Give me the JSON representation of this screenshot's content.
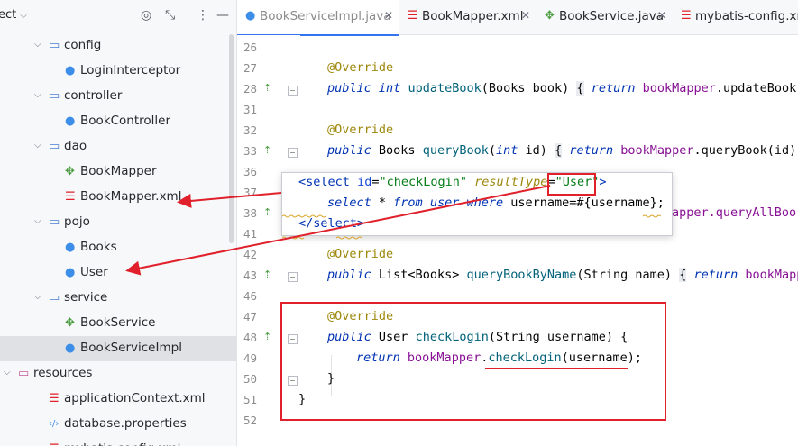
{
  "project_panel": {
    "title": "ect",
    "tree": [
      {
        "label": "config",
        "kind": "folder",
        "indent": 2,
        "expanded": true
      },
      {
        "label": "LoginInterceptor",
        "kind": "class",
        "indent": 3
      },
      {
        "label": "controller",
        "kind": "folder",
        "indent": 2,
        "expanded": true
      },
      {
        "label": "BookController",
        "kind": "class",
        "indent": 3
      },
      {
        "label": "dao",
        "kind": "folder",
        "indent": 2,
        "expanded": true
      },
      {
        "label": "BookMapper",
        "kind": "interface",
        "indent": 3
      },
      {
        "label": "BookMapper.xml",
        "kind": "xml",
        "indent": 3
      },
      {
        "label": "pojo",
        "kind": "folder",
        "indent": 2,
        "expanded": true
      },
      {
        "label": "Books",
        "kind": "class",
        "indent": 3
      },
      {
        "label": "User",
        "kind": "class",
        "indent": 3
      },
      {
        "label": "service",
        "kind": "folder",
        "indent": 2,
        "expanded": true
      },
      {
        "label": "BookService",
        "kind": "interface",
        "indent": 3
      },
      {
        "label": "BookServiceImpl",
        "kind": "class",
        "indent": 3,
        "selected": true
      },
      {
        "label": "resources",
        "kind": "resfolder",
        "indent": 1,
        "expanded": true
      },
      {
        "label": "applicationContext.xml",
        "kind": "xml",
        "indent": 2
      },
      {
        "label": "database.properties",
        "kind": "props",
        "indent": 2
      },
      {
        "label": "mybatis-config.xml",
        "kind": "xml",
        "indent": 2
      }
    ]
  },
  "tabs": [
    {
      "label": "BookServiceImpl.java",
      "icon": "java-class-icon",
      "active": true,
      "closable": true
    },
    {
      "label": "BookMapper.xml",
      "icon": "xml-icon",
      "active": false,
      "closable": true
    },
    {
      "label": "BookService.java",
      "icon": "interface-icon",
      "active": false,
      "closable": true
    },
    {
      "label": "mybatis-config.xml",
      "icon": "xml-icon",
      "active": false,
      "closable": false
    }
  ],
  "line_numbers": [
    "26",
    "27",
    "28",
    "31",
    "32",
    "33",
    "36",
    "37",
    "38",
    "41",
    "42",
    "43",
    "46",
    "47",
    "48",
    "49",
    "50",
    "51",
    "52"
  ],
  "code": {
    "l27": "@Override",
    "l28_kw1": "public",
    "l28_kw2": "int",
    "l28_meth": "updateBook",
    "l28_args": "(Books book) ",
    "l28_brace": "{",
    "l28_ret": "return",
    "l28_fld": "bookMapper",
    "l28_call": ".updateBook(",
    "l32": "@Override",
    "l33_kw1": "public",
    "l33_type": "Books",
    "l33_meth": "queryBook",
    "l33_p1": "(",
    "l33_kw2": "int",
    "l33_p2": " id) ",
    "l33_brace": "{",
    "l33_ret": "return",
    "l33_fld": "bookMapper",
    "l33_call": ".queryBook(id);",
    "l38_tail": "apper.queryAllBoo",
    "l42": "@Override",
    "l43_kw1": "public",
    "l43_type": "List<Books>",
    "l43_meth": "queryBookByName",
    "l43_args": "(String name) ",
    "l43_brace": "{",
    "l43_ret": "return",
    "l43_fld": "bookMappe",
    "l47": "@Override",
    "l48_kw1": "public",
    "l48_type": "User",
    "l48_meth": "checkLogin",
    "l48_args": "(String username) {",
    "l49_ret": "return",
    "l49_fld": "bookMapper",
    "l49_dot": ".",
    "l49_meth": "checkLogin",
    "l49_args": "(username);",
    "l50": "}",
    "l51": "}"
  },
  "popup": {
    "lt": "<",
    "tag_open": "select",
    "id_attr": "id",
    "id_val": "\"checkLogin\"",
    "rt_attr": "resultType",
    "rt_val": "\"User\"",
    "gt": ">",
    "sql_select": "select",
    "sql_star": " * ",
    "sql_from": "from",
    "sql_user": "user",
    "sql_where": "where",
    "sql_rest": " username=#{username};",
    "close_lt": "</",
    "tag_close": "select",
    "close_gt": ">"
  },
  "colors": {
    "annotation_red": "#e0202a",
    "active_tab_underline": "#3574f0"
  }
}
